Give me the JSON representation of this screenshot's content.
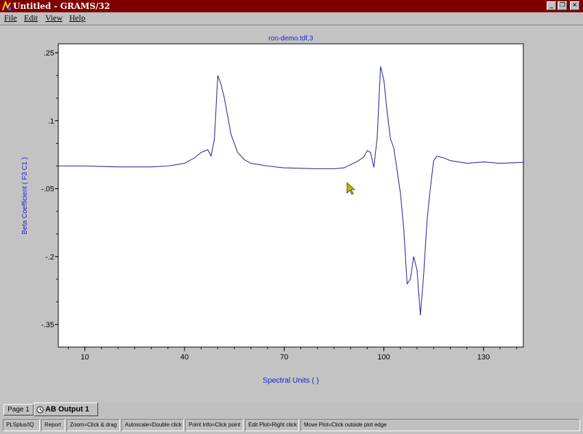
{
  "window": {
    "title": "Untitled - GRAMS/32",
    "controls": {
      "minimize": "_",
      "restore": "❐",
      "close": "✕"
    }
  },
  "menu": [
    {
      "label": "File"
    },
    {
      "label": "Edit"
    },
    {
      "label": "View"
    },
    {
      "label": "Help"
    }
  ],
  "chart_data": {
    "type": "line",
    "title": "ron-demo.tdf,3",
    "xlabel": "Spectral Units ( )",
    "ylabel": "Beta Coefficient ( F3 C1 )",
    "xlim": [
      2,
      142
    ],
    "ylim": [
      -0.4,
      0.27
    ],
    "xticks": [
      10,
      40,
      70,
      100,
      130
    ],
    "xtick_labels": [
      "10",
      "40",
      "70",
      "100",
      "130"
    ],
    "yticks": [
      0.25,
      0.1,
      -0.05,
      -0.2,
      -0.35
    ],
    "ytick_labels": [
      ".25",
      ".1",
      "-.05",
      "-.2",
      "-.35"
    ],
    "grid": false,
    "line_color": "#2c2c9c",
    "series": [
      {
        "x": [
          2,
          10,
          20,
          30,
          35,
          40,
          43,
          45,
          47,
          48,
          49,
          50,
          51,
          52,
          53,
          54,
          56,
          58,
          60,
          65,
          70,
          75,
          80,
          85,
          88,
          90,
          92,
          94,
          95,
          96,
          97,
          98,
          99,
          100,
          101,
          102,
          103,
          104,
          105,
          106,
          107,
          108,
          109,
          110,
          111,
          112,
          113,
          114,
          115,
          116,
          117,
          118,
          120,
          125,
          130,
          135,
          142
        ],
        "y": [
          -0.0,
          0.0,
          -0.002,
          -0.002,
          -0.0,
          0.006,
          0.018,
          0.03,
          0.036,
          0.022,
          0.06,
          0.2,
          0.18,
          0.15,
          0.11,
          0.07,
          0.03,
          0.014,
          0.006,
          0.0,
          -0.004,
          -0.005,
          -0.006,
          -0.006,
          -0.004,
          0.003,
          0.01,
          0.02,
          0.034,
          0.03,
          -0.003,
          0.062,
          0.22,
          0.19,
          0.12,
          0.06,
          0.04,
          -0.01,
          -0.06,
          -0.14,
          -0.26,
          -0.25,
          -0.2,
          -0.23,
          -0.33,
          -0.24,
          -0.12,
          -0.05,
          0.012,
          0.022,
          0.02,
          0.018,
          0.012,
          0.006,
          0.009,
          0.006,
          0.008
        ]
      }
    ]
  },
  "tabs": [
    {
      "label": "Page 1"
    },
    {
      "label": "AB Output 1"
    }
  ],
  "status": [
    "PLSplus/IQ",
    "Report",
    "Zoom=Click & drag",
    "Autoscale=Double click",
    "Point Info=Click point",
    "Edit Plot=Right click",
    "Move Plot=Click outside plot edge"
  ]
}
